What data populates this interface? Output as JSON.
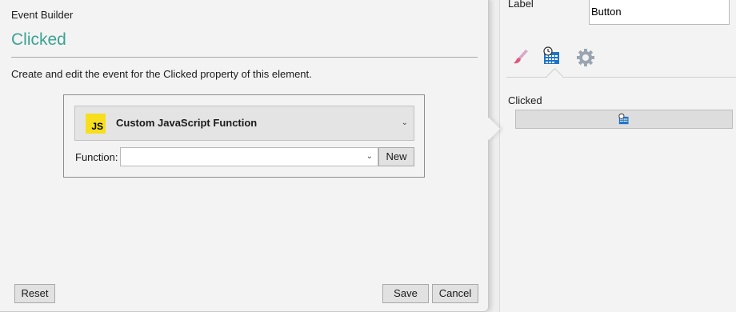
{
  "properties": {
    "label_caption": "Label",
    "label_value": "Button",
    "tabs": [
      {
        "icon": "paintbrush-icon"
      },
      {
        "icon": "event-calendar-icon",
        "active": true
      },
      {
        "icon": "gear-icon"
      }
    ],
    "event_property": "Clicked"
  },
  "dialog": {
    "title": "Event Builder",
    "heading": "Clicked",
    "description": "Create and edit the event for the Clicked property of this element.",
    "action_type": "Custom JavaScript Function",
    "js_badge": "JS",
    "function_label": "Function:",
    "function_value": "",
    "new_button": "New",
    "reset_button": "Reset",
    "save_button": "Save",
    "cancel_button": "Cancel"
  },
  "colors": {
    "accent": "#3aa394",
    "js_yellow": "#f7df1e",
    "calendar_blue": "#1f74c6"
  }
}
